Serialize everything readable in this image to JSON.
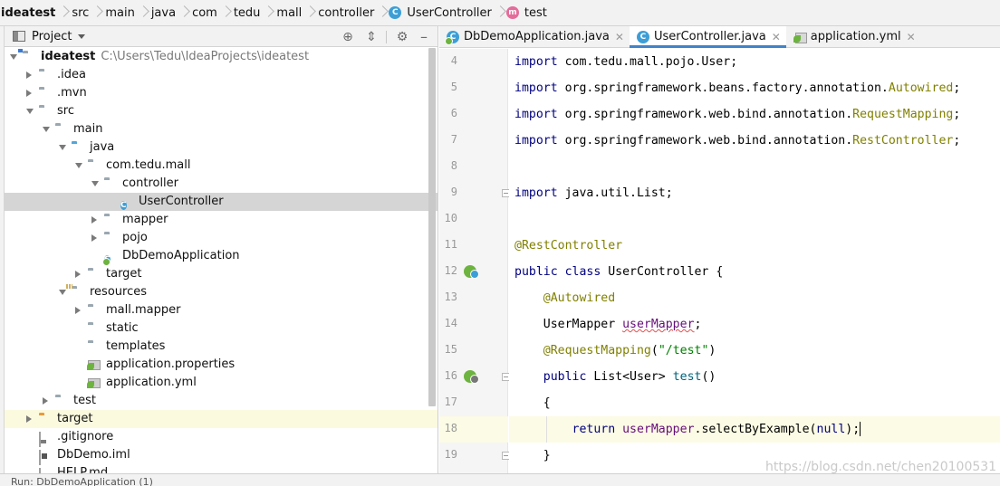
{
  "breadcrumb": [
    {
      "label": "ideatest",
      "icon": "module-folder-icon"
    },
    {
      "label": "src",
      "icon": "folder-icon"
    },
    {
      "label": "main",
      "icon": "folder-icon"
    },
    {
      "label": "java",
      "icon": "folder-icon"
    },
    {
      "label": "com",
      "icon": "package-icon"
    },
    {
      "label": "tedu",
      "icon": "package-icon"
    },
    {
      "label": "mall",
      "icon": "package-icon"
    },
    {
      "label": "controller",
      "icon": "package-icon"
    },
    {
      "label": "UserController",
      "icon": "class-icon",
      "badge": "C"
    },
    {
      "label": "test",
      "icon": "method-icon",
      "badge": "m"
    }
  ],
  "project_panel": {
    "title": "Project",
    "tree": [
      {
        "label": "ideatest",
        "sub": "C:\\Users\\Tedu\\IdeaProjects\\ideatest",
        "depth": 0,
        "arrow": "down",
        "icon": "module-folder-icon",
        "bold": true
      },
      {
        "label": ".idea",
        "depth": 1,
        "arrow": "right",
        "icon": "folder-icon"
      },
      {
        "label": ".mvn",
        "depth": 1,
        "arrow": "right",
        "icon": "folder-icon"
      },
      {
        "label": "src",
        "depth": 1,
        "arrow": "down",
        "icon": "folder-icon"
      },
      {
        "label": "main",
        "depth": 2,
        "arrow": "down",
        "icon": "folder-icon"
      },
      {
        "label": "java",
        "depth": 3,
        "arrow": "down",
        "icon": "source-folder-icon"
      },
      {
        "label": "com.tedu.mall",
        "depth": 4,
        "arrow": "down",
        "icon": "package-icon"
      },
      {
        "label": "controller",
        "depth": 5,
        "arrow": "down",
        "icon": "package-icon"
      },
      {
        "label": "UserController",
        "depth": 6,
        "arrow": "none",
        "icon": "class-icon",
        "badge": "C",
        "selected": true
      },
      {
        "label": "mapper",
        "depth": 5,
        "arrow": "right",
        "icon": "package-icon"
      },
      {
        "label": "pojo",
        "depth": 5,
        "arrow": "right",
        "icon": "package-icon"
      },
      {
        "label": "DbDemoApplication",
        "depth": 5,
        "arrow": "none",
        "icon": "spring-class-icon",
        "badge": "C"
      },
      {
        "label": "target",
        "depth": 4,
        "arrow": "right",
        "icon": "folder-icon"
      },
      {
        "label": "resources",
        "depth": 3,
        "arrow": "down",
        "icon": "resources-folder-icon"
      },
      {
        "label": "mall.mapper",
        "depth": 4,
        "arrow": "right",
        "icon": "folder-icon"
      },
      {
        "label": "static",
        "depth": 4,
        "arrow": "none",
        "icon": "folder-icon"
      },
      {
        "label": "templates",
        "depth": 4,
        "arrow": "none",
        "icon": "folder-icon"
      },
      {
        "label": "application.properties",
        "depth": 4,
        "arrow": "none",
        "icon": "spring-config-icon"
      },
      {
        "label": "application.yml",
        "depth": 4,
        "arrow": "none",
        "icon": "spring-config-icon"
      },
      {
        "label": "test",
        "depth": 2,
        "arrow": "right",
        "icon": "folder-icon"
      },
      {
        "label": "target",
        "depth": 1,
        "arrow": "right",
        "icon": "excluded-folder-icon",
        "excluded": true
      },
      {
        "label": ".gitignore",
        "depth": 1,
        "arrow": "none",
        "icon": "gitignore-file-icon"
      },
      {
        "label": "DbDemo.iml",
        "depth": 1,
        "arrow": "none",
        "icon": "iml-file-icon"
      },
      {
        "label": "HELP.md",
        "depth": 1,
        "arrow": "none",
        "icon": "markdown-file-icon"
      }
    ]
  },
  "tabs": [
    {
      "label": "DbDemoApplication.java",
      "icon": "spring-class-icon",
      "badge": "C",
      "active": false
    },
    {
      "label": "UserController.java",
      "icon": "class-icon",
      "badge": "C",
      "active": true
    },
    {
      "label": "application.yml",
      "icon": "spring-config-icon",
      "active": false
    }
  ],
  "editor": {
    "lines": [
      {
        "num": "4"
      },
      {
        "num": "5"
      },
      {
        "num": "6"
      },
      {
        "num": "7"
      },
      {
        "num": "8"
      },
      {
        "num": "9"
      },
      {
        "num": "10"
      },
      {
        "num": "11"
      },
      {
        "num": "12",
        "gutter_icon": "spring-bean-class-icon"
      },
      {
        "num": "13"
      },
      {
        "num": "14"
      },
      {
        "num": "15"
      },
      {
        "num": "16",
        "gutter_icon": "spring-request-mapping-icon"
      },
      {
        "num": "17"
      },
      {
        "num": "18",
        "current": true
      },
      {
        "num": "19"
      }
    ],
    "code": {
      "l4_kw": "import",
      "l4_rest": " com.tedu.mall.pojo.User;",
      "l5_kw": "import",
      "l5_pre": " org.springframework.beans.factory.annotation.",
      "l5_ann": "Autowired",
      "l5_end": ";",
      "l6_kw": "import",
      "l6_pre": " org.springframework.web.bind.annotation.",
      "l6_ann": "RequestMapping",
      "l6_end": ";",
      "l7_kw": "import",
      "l7_pre": " org.springframework.web.bind.annotation.",
      "l7_ann": "RestController",
      "l7_end": ";",
      "l9_kw": "import",
      "l9_rest": " java.util.List;",
      "l11_ann": "@RestController",
      "l12_kw": "public class",
      "l12_rest": " UserController {",
      "l13_ann": "@Autowired",
      "l14_type": "UserMapper ",
      "l14_field": "userMapper",
      "l14_end": ";",
      "l15_ann": "@RequestMapping",
      "l15_open": "(",
      "l15_str": "\"/test\"",
      "l15_close": ")",
      "l16_kw": "public",
      "l16_type": " List<User> ",
      "l16_name": "test",
      "l16_end": "()",
      "l17": "{",
      "l18_kw": "return ",
      "l18_field": "userMapper",
      "l18_mid": ".selectByExample(",
      "l18_null": "null",
      "l18_end": ");",
      "l19": "}"
    }
  },
  "bottom_bar": {
    "text": "Run:   DbDemoApplication (1)"
  },
  "watermark": "https://blog.csdn.net/chen20100531",
  "colors": {
    "keyword": "#000080",
    "annotation": "#808000",
    "string": "#008000",
    "field": "#660e7a",
    "selection": "#d5d5d5",
    "accent_tab": "#4083c9"
  }
}
